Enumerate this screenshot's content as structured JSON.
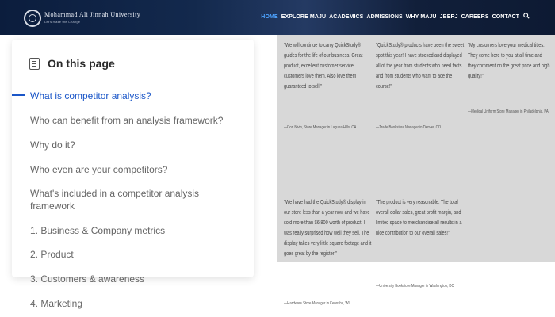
{
  "header": {
    "university_name": "Mohammad Ali Jinnah University",
    "university_sub": "Let's make the Change",
    "nav": [
      {
        "label": "HOME",
        "active": true
      },
      {
        "label": "EXPLORE MAJU",
        "active": false
      },
      {
        "label": "ACADEMICS",
        "active": false
      },
      {
        "label": "ADMISSIONS",
        "active": false
      },
      {
        "label": "WHY MAJU",
        "active": false
      },
      {
        "label": "JBERJ",
        "active": false
      },
      {
        "label": "CAREERS",
        "active": false
      },
      {
        "label": "CONTACT",
        "active": false
      }
    ],
    "search_icon": "search-icon"
  },
  "sidebar": {
    "title": "On this page",
    "items": [
      "What is competitor analysis?",
      "Who can benefit from an analysis framework?",
      "Why do it?",
      "Who even are your competitors?",
      "What's included in a competitor analysis framework",
      "1. Business & Company metrics",
      "2. Product",
      "3. Customers & awareness",
      "4. Marketing"
    ],
    "active_index": 0,
    "accent_color": "#1a56c8"
  },
  "testimonials": [
    {
      "quote": "\"We will continue to carry QuickStudy® guides for the life of our business. Great product, excellent customer service, customers love them. Also love them guaranteed to sell.\"",
      "author": "—Don Nivin, Store Manager in Laguna Hills, CA"
    },
    {
      "quote": "\"QuickStudy® products have been the sweet spot this year! I have stocked and displayed all of the year from students who need facts and from students who want to ace the course!\"",
      "author": "—Trade Bookstore Manager in Denver, CO"
    },
    {
      "quote": "\"My customers love your medical titles. They come here to you at all time and they comment on the great price and high quality!\"",
      "author": "—Medical Uniform Store Manager in Philadelphia, PA"
    },
    {
      "quote": "\"We have had the QuickStudy® display in our store less than a year now and we have sold more than $6,800 worth of product. I was really surprised how well they sell. The display takes very little square footage and it goes great by the register!\"",
      "author": "—Hardware Store Manager in Kenosha, WI"
    },
    {
      "quote": "\"The product is very reasonable. The total overall dollar sales, great profit margin, and limited space to merchandise all results in a nice contribution to our overall sales!\"",
      "author": "—University Bookstore Manager in Washington, DC"
    }
  ]
}
